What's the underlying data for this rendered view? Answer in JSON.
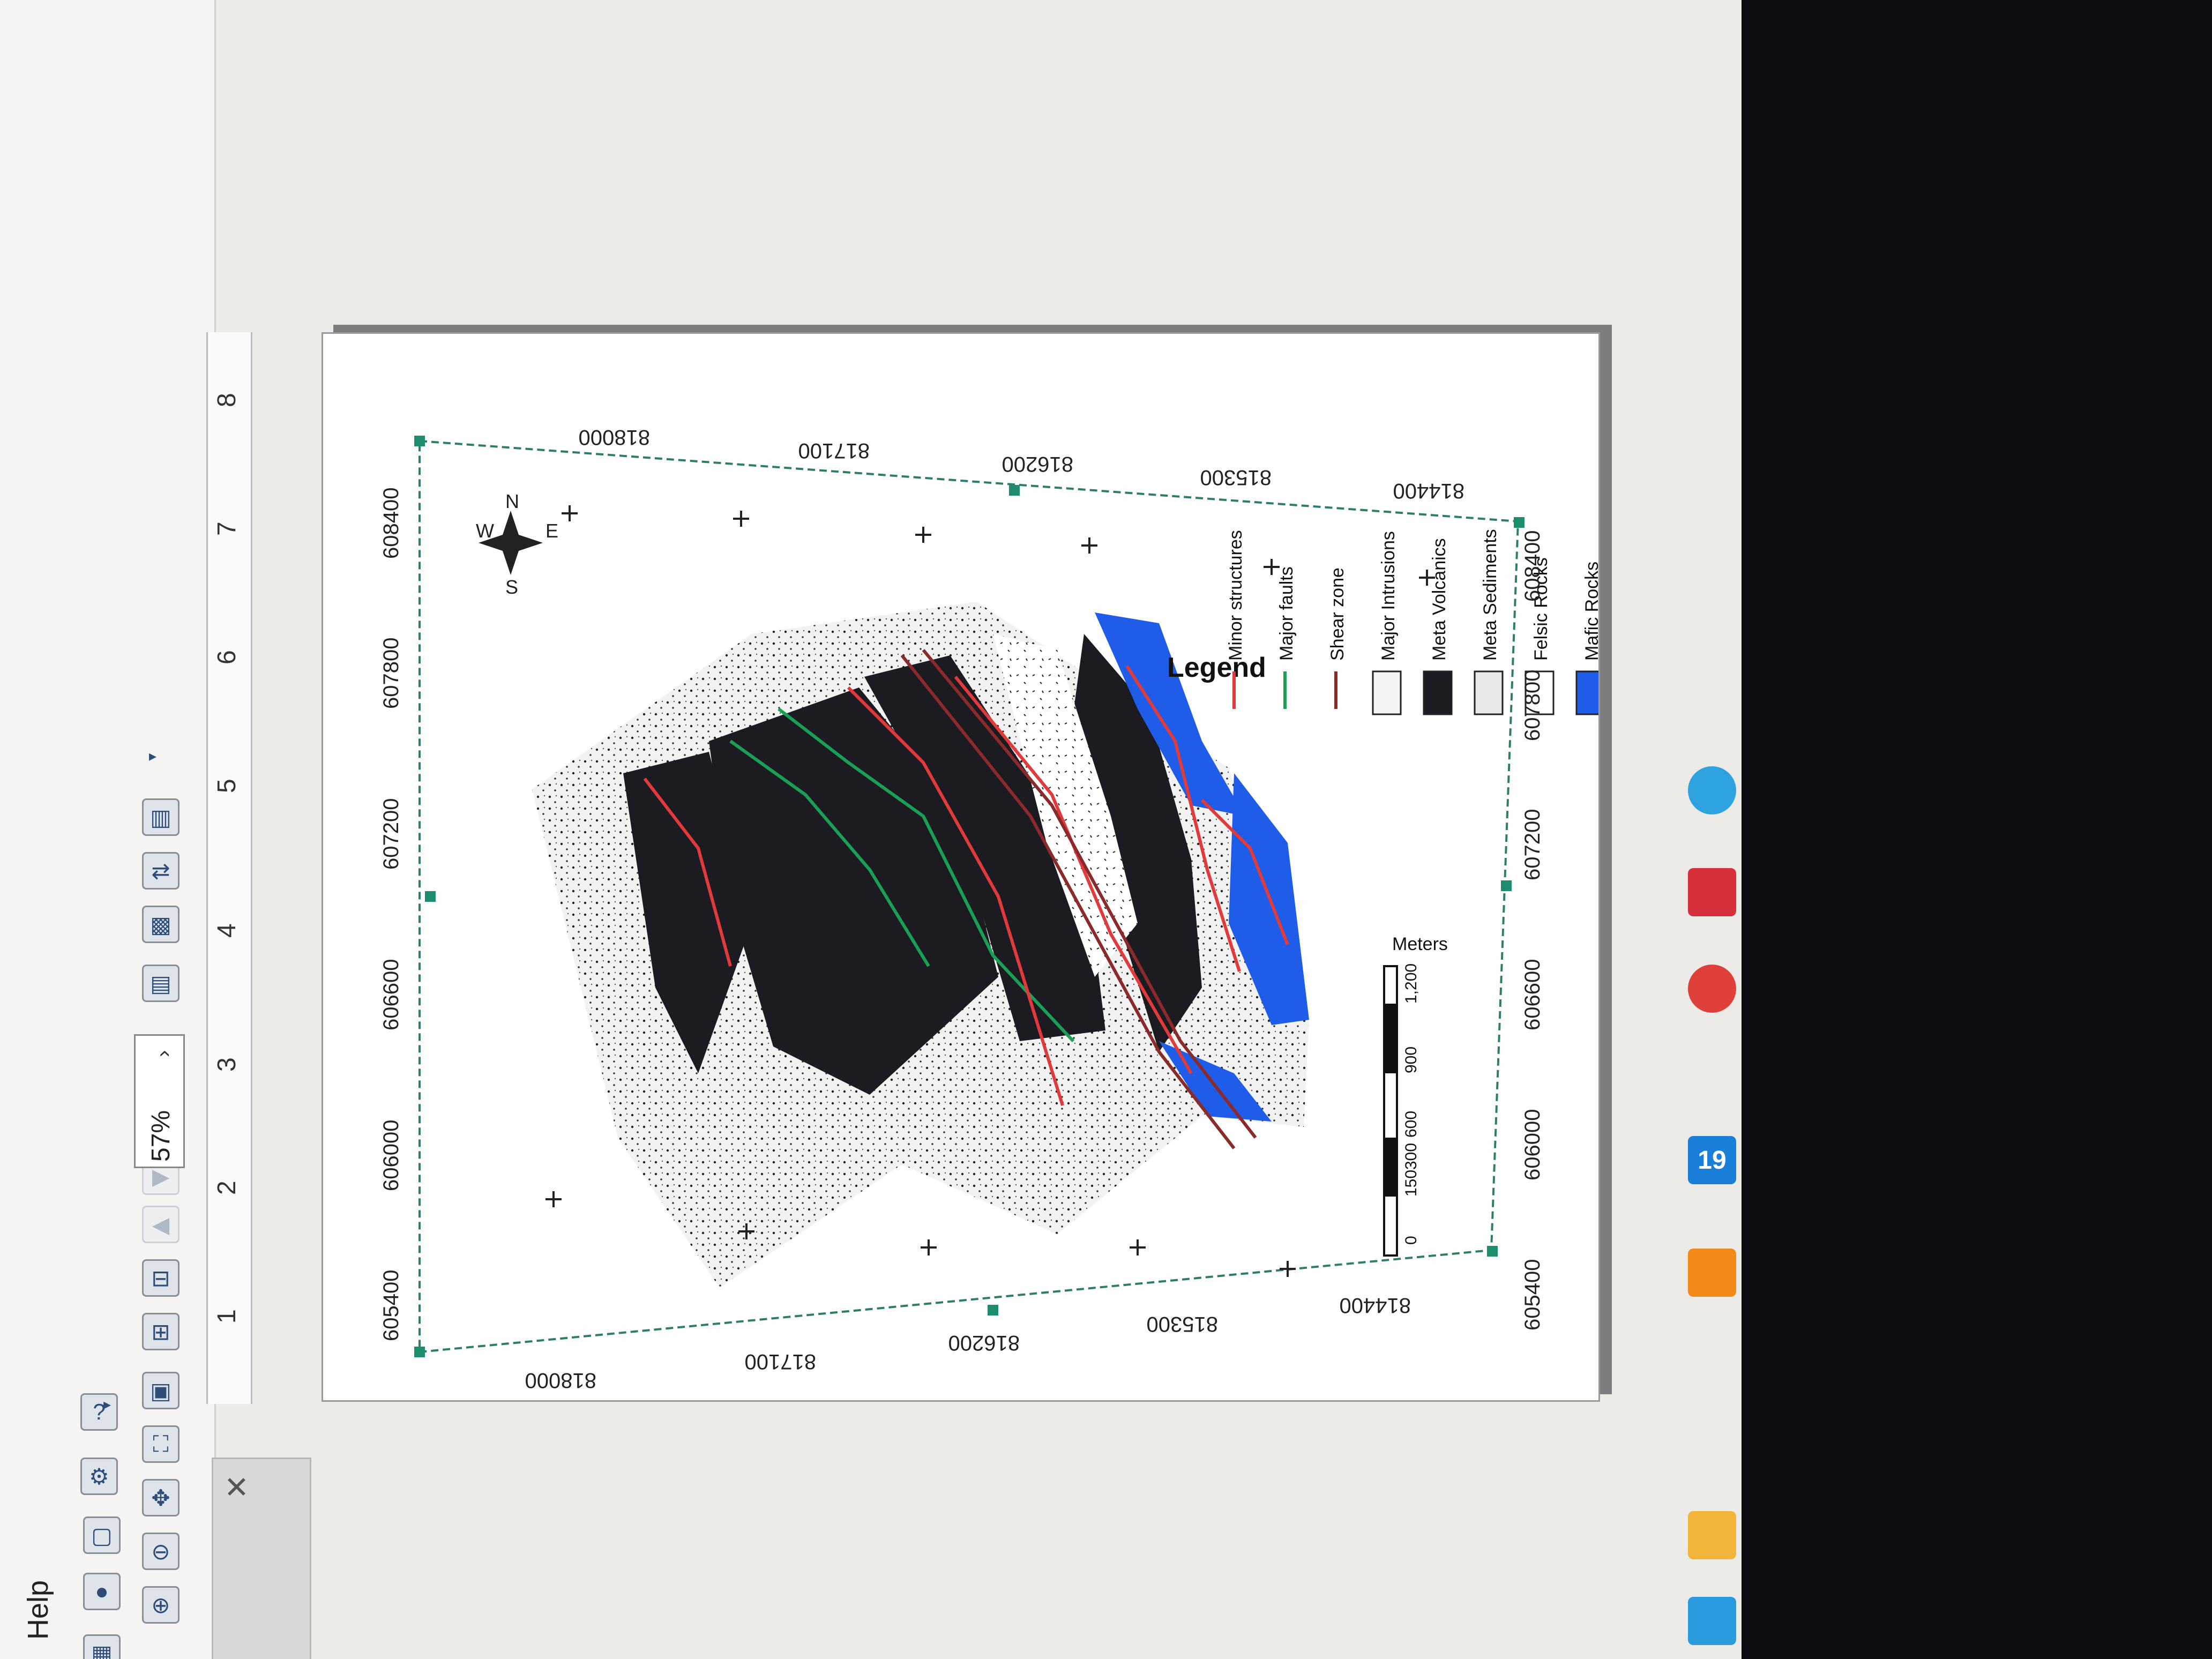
{
  "menu": {
    "help": "Help"
  },
  "toolbar": {
    "zoom_value": "57%",
    "overflow_glyph": "▸"
  },
  "ruler": {
    "marks": [
      "1",
      "2",
      "3",
      "4",
      "5",
      "6",
      "7",
      "8"
    ]
  },
  "map": {
    "legend_title": "Legend",
    "legend_items": [
      {
        "label": "Minor structures",
        "type": "line",
        "color": "#e03a3a"
      },
      {
        "label": "Major faults",
        "type": "line",
        "color": "#1aa055"
      },
      {
        "label": "Shear zone",
        "type": "line",
        "color": "#8a2a2a"
      },
      {
        "label": "Major Intrusions",
        "type": "patch",
        "color": "#f4f4f4"
      },
      {
        "label": "Meta Volcanics",
        "type": "patch",
        "color": "#1d1b22"
      },
      {
        "label": "Meta Sediments",
        "type": "patch",
        "color": "#e8e8e8"
      },
      {
        "label": "Felsic Rocks",
        "type": "patch",
        "color": "#ffffff"
      },
      {
        "label": "Mafic Rocks",
        "type": "patch",
        "color": "#1f5de8"
      }
    ],
    "easting_labels": [
      "605400",
      "606000",
      "606600",
      "607200",
      "607800",
      "608400"
    ],
    "northing_labels": [
      "818000",
      "817100",
      "816200",
      "815300",
      "814400"
    ],
    "north_arrow": {
      "n": "N",
      "s": "S",
      "e": "E",
      "w": "W"
    },
    "scale_bar": {
      "unit": "Meters",
      "ticks": [
        "0",
        "150",
        "300",
        "600",
        "900",
        "1,200"
      ]
    }
  },
  "taskbar": {
    "apps": [
      {
        "name": "edge-icon",
        "color": "#2b9be0"
      },
      {
        "name": "file-explorer-icon",
        "color": "#f2b53a"
      },
      {
        "name": "vlc-icon",
        "color": "#f28a1a"
      },
      {
        "name": "app-19-icon",
        "label": "19",
        "color": "#1a7fd9"
      },
      {
        "name": "chrome-icon",
        "color": "#e0403a"
      },
      {
        "name": "app-red-icon",
        "color": "#d6303a"
      },
      {
        "name": "globe-icon",
        "color": "#2fa3e0"
      }
    ]
  }
}
